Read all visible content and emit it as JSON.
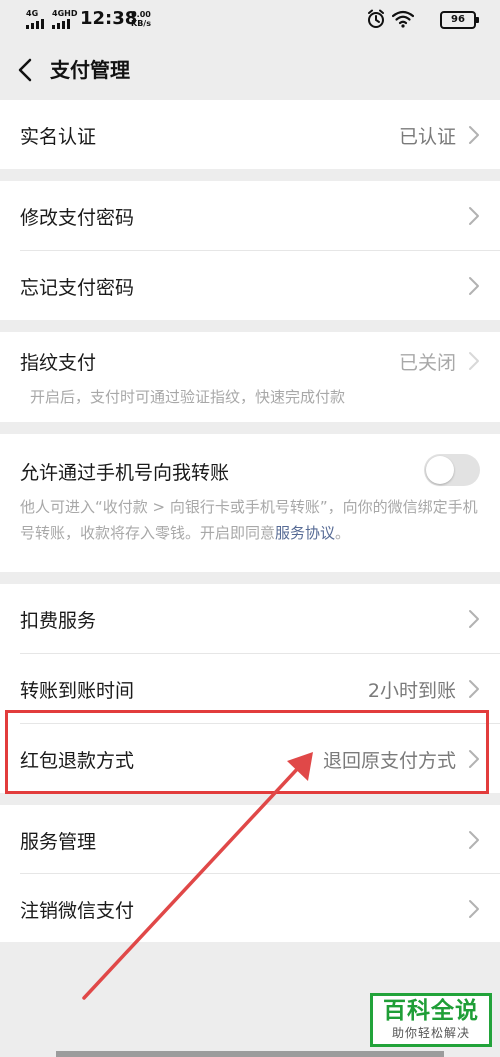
{
  "status_bar": {
    "network_1": "4G",
    "network_2": "4GHD",
    "time": "12:38",
    "speed_value": "0.00",
    "speed_unit": "KB/s",
    "battery": "96",
    "icons": [
      "alarm-icon",
      "wifi-icon",
      "battery-icon"
    ]
  },
  "nav": {
    "back_icon": "chevron-left-icon",
    "title": "支付管理"
  },
  "settings": {
    "real_name": {
      "label": "实名认证",
      "value": "已认证"
    },
    "change_password": {
      "label": "修改支付密码"
    },
    "forgot_password": {
      "label": "忘记支付密码"
    },
    "fingerprint": {
      "label": "指纹支付",
      "value": "已关闭",
      "description": "开启后，支付时可通过验证指纹，快速完成付款"
    },
    "phone_transfer": {
      "label": "允许通过手机号向我转账",
      "enabled": false,
      "description": "他人可进入“收付款 > 向银行卡或手机号转账”，向你的微信绑定手机号转账，收款将存入零钱。开启即同意",
      "link_text": "服务协议",
      "description_end": "。"
    },
    "deduction": {
      "label": "扣费服务"
    },
    "transfer_time": {
      "label": "转账到账时间",
      "value": "2小时到账"
    },
    "red_packet_refund": {
      "label": "红包退款方式",
      "value": "退回原支付方式"
    },
    "service_management": {
      "label": "服务管理"
    },
    "close_wechat_pay": {
      "label": "注销微信支付"
    }
  },
  "watermark": {
    "title": "百科全说",
    "subtitle": "助你轻松解决"
  },
  "colors": {
    "background": "#ededed",
    "card": "#ffffff",
    "link": "#576b95",
    "annotation": "#e23c3c",
    "watermark_green": "#1f9e37"
  }
}
